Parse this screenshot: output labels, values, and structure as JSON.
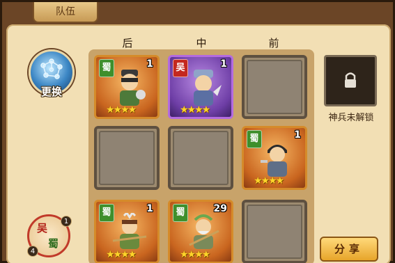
{
  "tab": {
    "label": "队伍"
  },
  "columns": [
    "后",
    "中",
    "前"
  ],
  "swap": {
    "label": "更换"
  },
  "faction_orb": {
    "top": "吴",
    "bottom": "蜀",
    "badge_top": "1",
    "badge_bottom": "4"
  },
  "lock": {
    "label": "神兵未解锁"
  },
  "share": {
    "label": "分享"
  },
  "slots": [
    {
      "faction": "蜀",
      "level": "1",
      "stars": "★★★★",
      "rarity": "orange"
    },
    {
      "faction": "吴",
      "level": "1",
      "stars": "★★★★",
      "rarity": "purple"
    },
    null,
    null,
    null,
    {
      "faction": "蜀",
      "level": "1",
      "stars": "★★★★",
      "rarity": "orange"
    },
    {
      "faction": "蜀",
      "level": "1",
      "stars": "★★★★",
      "rarity": "orange"
    },
    {
      "faction": "蜀",
      "level": "29",
      "stars": "★★★★",
      "rarity": "orange"
    },
    null
  ],
  "colors": {
    "shu": "#3e8f2c",
    "wu": "#c4281f",
    "accent": "#e7a52a"
  }
}
